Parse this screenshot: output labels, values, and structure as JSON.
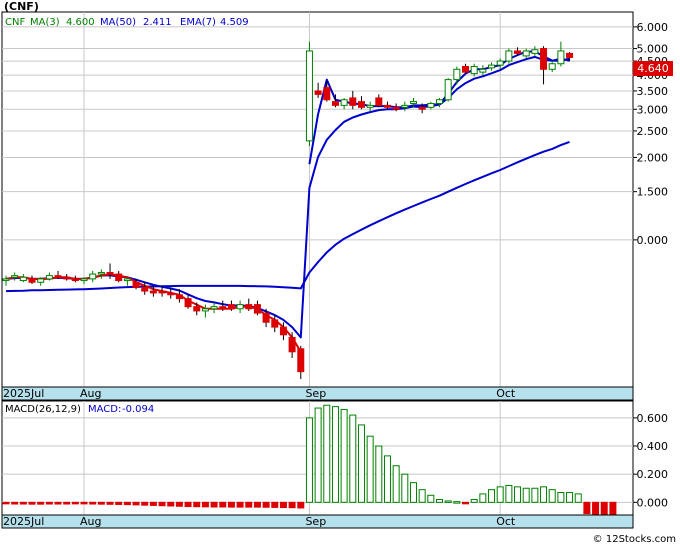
{
  "chart_data": [
    {
      "type": "candlestick",
      "title": "(CNF)",
      "legend": {
        "ticker": "CNF",
        "ma3_label": "MA(3)",
        "ma3_value": "4.600",
        "ma50_label": "MA(50)",
        "ma50_value": "2.411",
        "ema7_label": "EMA(7)",
        "ema7_value": "4.509"
      },
      "last_price_label": "4.640",
      "y_scale": "log",
      "y_ticks": [
        "6.000",
        "5.000",
        "4.500",
        "4.000",
        "3.500",
        "3.000",
        "2.500",
        "2.000",
        "1.500",
        "0.000"
      ],
      "x_labels": [
        "2025Jul",
        "Aug",
        "Sep",
        "Oct"
      ],
      "grid": true,
      "colors": {
        "up": "#008000",
        "down": "#dd0000",
        "ma": "#0000cc",
        "ema": "#dd0000",
        "price_tag": "#dd0000"
      },
      "candles": [
        [
          0.72,
          0.74,
          0.68,
          0.72
        ],
        [
          0.73,
          0.76,
          0.71,
          0.74
        ],
        [
          0.71,
          0.75,
          0.7,
          0.73
        ],
        [
          0.72,
          0.74,
          0.69,
          0.7
        ],
        [
          0.7,
          0.73,
          0.68,
          0.72
        ],
        [
          0.72,
          0.76,
          0.71,
          0.74
        ],
        [
          0.74,
          0.77,
          0.72,
          0.73
        ],
        [
          0.73,
          0.75,
          0.71,
          0.72
        ],
        [
          0.72,
          0.74,
          0.7,
          0.71
        ],
        [
          0.71,
          0.73,
          0.69,
          0.72
        ],
        [
          0.72,
          0.77,
          0.7,
          0.75
        ],
        [
          0.75,
          0.78,
          0.72,
          0.76
        ],
        [
          0.76,
          0.82,
          0.72,
          0.75
        ],
        [
          0.75,
          0.77,
          0.7,
          0.71
        ],
        [
          0.71,
          0.73,
          0.68,
          0.72
        ],
        [
          0.7,
          0.72,
          0.66,
          0.67
        ],
        [
          0.67,
          0.7,
          0.63,
          0.65
        ],
        [
          0.65,
          0.68,
          0.62,
          0.64
        ],
        [
          0.65,
          0.68,
          0.62,
          0.64
        ],
        [
          0.64,
          0.67,
          0.61,
          0.63
        ],
        [
          0.63,
          0.66,
          0.59,
          0.61
        ],
        [
          0.61,
          0.63,
          0.56,
          0.57
        ],
        [
          0.57,
          0.59,
          0.53,
          0.55
        ],
        [
          0.55,
          0.58,
          0.52,
          0.56
        ],
        [
          0.56,
          0.59,
          0.54,
          0.57
        ],
        [
          0.57,
          0.6,
          0.55,
          0.56
        ],
        [
          0.58,
          0.6,
          0.55,
          0.56
        ],
        [
          0.56,
          0.6,
          0.54,
          0.58
        ],
        [
          0.58,
          0.61,
          0.55,
          0.56
        ],
        [
          0.58,
          0.6,
          0.53,
          0.54
        ],
        [
          0.54,
          0.56,
          0.48,
          0.5
        ],
        [
          0.51,
          0.53,
          0.46,
          0.48
        ],
        [
          0.48,
          0.5,
          0.43,
          0.45
        ],
        [
          0.44,
          0.46,
          0.37,
          0.39
        ],
        [
          0.4,
          0.41,
          0.31,
          0.33
        ],
        [
          2.3,
          5.3,
          2.2,
          4.9
        ],
        [
          3.5,
          3.75,
          3.3,
          3.4
        ],
        [
          3.6,
          3.8,
          3.2,
          3.25
        ],
        [
          3.2,
          3.4,
          3.05,
          3.1
        ],
        [
          3.1,
          3.3,
          3.0,
          3.25
        ],
        [
          3.3,
          3.5,
          3.0,
          3.1
        ],
        [
          3.2,
          3.35,
          3.0,
          3.05
        ],
        [
          3.05,
          3.2,
          2.95,
          3.1
        ],
        [
          3.3,
          3.4,
          3.05,
          3.1
        ],
        [
          3.1,
          3.2,
          3.0,
          3.05
        ],
        [
          3.05,
          3.15,
          2.95,
          3.0
        ],
        [
          3.05,
          3.2,
          2.95,
          3.1
        ],
        [
          3.15,
          3.3,
          3.05,
          3.2
        ],
        [
          3.05,
          3.15,
          2.9,
          3.0
        ],
        [
          3.05,
          3.2,
          3.0,
          3.15
        ],
        [
          3.15,
          3.3,
          3.05,
          3.25
        ],
        [
          3.25,
          3.9,
          3.2,
          3.85
        ],
        [
          3.85,
          4.3,
          3.7,
          4.2
        ],
        [
          4.3,
          4.4,
          4.05,
          4.1
        ],
        [
          4.05,
          4.4,
          3.95,
          4.3
        ],
        [
          4.1,
          4.35,
          4.0,
          4.2
        ],
        [
          4.25,
          4.45,
          4.15,
          4.35
        ],
        [
          4.35,
          4.6,
          4.2,
          4.5
        ],
        [
          4.5,
          5.0,
          4.4,
          4.9
        ],
        [
          4.9,
          5.05,
          4.7,
          4.8
        ],
        [
          4.7,
          5.0,
          4.6,
          4.9
        ],
        [
          4.8,
          5.1,
          4.7,
          4.95
        ],
        [
          5.0,
          5.1,
          3.7,
          4.2
        ],
        [
          4.2,
          4.5,
          4.1,
          4.4
        ],
        [
          4.4,
          5.3,
          4.3,
          4.9
        ],
        [
          4.8,
          4.85,
          4.5,
          4.64
        ]
      ],
      "ma3": [
        0.72,
        0.73,
        0.73,
        0.72,
        0.72,
        0.72,
        0.73,
        0.73,
        0.72,
        0.72,
        0.73,
        0.74,
        0.75,
        0.74,
        0.73,
        0.7,
        0.68,
        0.66,
        0.65,
        0.64,
        0.63,
        0.6,
        0.58,
        0.56,
        0.56,
        0.56,
        0.56,
        0.57,
        0.57,
        0.56,
        0.53,
        0.51,
        0.48,
        0.44,
        0.39,
        1.89,
        2.88,
        3.85,
        3.25,
        3.2,
        3.15,
        3.13,
        3.08,
        3.08,
        3.08,
        3.05,
        3.05,
        3.1,
        3.1,
        3.12,
        3.13,
        3.42,
        3.77,
        4.05,
        4.2,
        4.2,
        4.28,
        4.35,
        4.58,
        4.73,
        4.87,
        4.88,
        4.68,
        4.52,
        4.5,
        4.6
      ],
      "ema7": [
        0.72,
        0.725,
        0.727,
        0.72,
        0.72,
        0.725,
        0.727,
        0.725,
        0.72,
        0.72,
        0.728,
        0.74,
        0.743,
        0.735,
        0.73,
        0.715,
        0.7,
        0.685,
        0.674,
        0.664,
        0.653,
        0.632,
        0.612,
        0.598,
        0.591,
        0.582,
        0.575,
        0.576,
        0.572,
        0.564,
        0.548,
        0.531,
        0.51,
        0.48,
        0.44,
        1.55,
        2.01,
        2.32,
        2.52,
        2.7,
        2.8,
        2.87,
        2.93,
        2.98,
        3.0,
        3.0,
        3.03,
        3.07,
        3.05,
        3.08,
        3.12,
        3.3,
        3.55,
        3.74,
        3.88,
        3.96,
        4.06,
        4.17,
        4.35,
        4.46,
        4.57,
        4.66,
        4.55,
        4.51,
        4.6,
        4.509
      ],
      "ma50": [
        0.65,
        0.651,
        0.652,
        0.654,
        0.655,
        0.656,
        0.657,
        0.658,
        0.659,
        0.66,
        0.662,
        0.664,
        0.667,
        0.67,
        0.672,
        0.674,
        0.675,
        0.676,
        0.677,
        0.678,
        0.679,
        0.679,
        0.679,
        0.679,
        0.679,
        0.679,
        0.679,
        0.679,
        0.678,
        0.677,
        0.676,
        0.674,
        0.671,
        0.668,
        0.665,
        0.76,
        0.83,
        0.9,
        0.96,
        1.01,
        1.05,
        1.09,
        1.13,
        1.17,
        1.21,
        1.25,
        1.29,
        1.33,
        1.37,
        1.41,
        1.45,
        1.5,
        1.55,
        1.6,
        1.65,
        1.7,
        1.75,
        1.8,
        1.86,
        1.92,
        1.98,
        2.04,
        2.1,
        2.15,
        2.22,
        2.28,
        2.33,
        2.411
      ]
    },
    {
      "type": "bar",
      "title": "MACD(26,12,9)",
      "legend": {
        "label": "MACD(26,12,9)",
        "macd_label": "MACD:",
        "macd_value": "-0.094"
      },
      "y_ticks": [
        "0.600",
        "0.400",
        "0.200",
        "0.000"
      ],
      "ylim": [
        -0.09,
        0.72
      ],
      "x_labels": [
        "2025Jul",
        "Aug",
        "Sep",
        "Oct"
      ],
      "values": [
        -0.01,
        -0.012,
        -0.012,
        -0.013,
        -0.013,
        -0.012,
        -0.012,
        -0.012,
        -0.011,
        -0.011,
        -0.012,
        -0.013,
        -0.014,
        -0.015,
        -0.016,
        -0.018,
        -0.02,
        -0.022,
        -0.024,
        -0.026,
        -0.028,
        -0.03,
        -0.031,
        -0.032,
        -0.033,
        -0.033,
        -0.034,
        -0.034,
        -0.034,
        -0.034,
        -0.035,
        -0.036,
        -0.037,
        -0.038,
        -0.04,
        0.6,
        0.67,
        0.69,
        0.68,
        0.66,
        0.62,
        0.55,
        0.47,
        0.4,
        0.33,
        0.26,
        0.2,
        0.14,
        0.09,
        0.05,
        0.02,
        0.01,
        0.005,
        -0.005,
        0.02,
        0.06,
        0.09,
        0.11,
        0.12,
        0.11,
        0.1,
        0.1,
        0.11,
        0.09,
        0.07,
        0.07,
        0.06,
        -0.08,
        -0.09,
        -0.09,
        -0.094
      ]
    }
  ],
  "watermark": "© 12Stocks.com"
}
